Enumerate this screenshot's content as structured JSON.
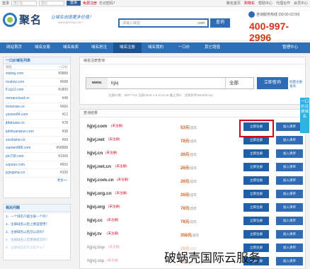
{
  "topbar": {
    "user_placeholder": "用户名",
    "pass_placeholder": "密码",
    "login_label": "登录",
    "free_register": "免费注册",
    "forgot": "忘记密码？",
    "links": [
      "聚名首页",
      "购物车",
      "帮助中心",
      "代理合作",
      "会员中心"
    ]
  },
  "header": {
    "logo": "聚名",
    "slogan": "让域名创造更多价值！",
    "site": "www.juming.com",
    "search_placeholder": "请输入域名",
    "search_tld": ".com",
    "search_button": "查询",
    "hotline_label": "咨询服务热线 (09:00-22:00)",
    "hotline": "400-997-2996"
  },
  "nav": {
    "items": [
      "网站首页",
      "域名交易",
      "域名拍卖",
      "域名抢注",
      "域名注册",
      "域名我的",
      "一口价",
      "其它增值"
    ],
    "active_index": 4,
    "manage": "管理中心"
  },
  "sidebar": {
    "title": "一口价域名列表",
    "col_domain": "域名",
    "col_price": "一口价",
    "items": [
      {
        "domain": "xinjing.com",
        "price": "¥9888"
      },
      {
        "domain": "ncabsy.com",
        "price": "¥688"
      },
      {
        "domain": "fl.cp12.com",
        "price": "¥1800"
      },
      {
        "domain": "nvmancloud.cn",
        "price": "¥48"
      },
      {
        "domain": "brownise.cn",
        "price": "¥966"
      },
      {
        "domain": "youme84.com",
        "price": "¥12"
      },
      {
        "domain": "jbfahuive.cn",
        "price": "¥78"
      },
      {
        "domain": "ipbihuanqrun.com",
        "price": "¥38"
      },
      {
        "domain": "xinzhishe.cn",
        "price": "¥99"
      },
      {
        "domain": "xiamen888.com",
        "price": "¥58888"
      },
      {
        "domain": "pic738.com",
        "price": "¥1000"
      },
      {
        "domain": "szjurun.com",
        "price": "¥500"
      },
      {
        "domain": "jzjingshui.cn",
        "price": "¥100"
      }
    ],
    "more": "更多>>"
  },
  "related": {
    "title": "相关问题",
    "items": [
      "1、一个域名只能注册一个吗？",
      "2、注册域名以后上哪里使用？",
      "3、注册域名以后可以卖吗？",
      "4、注册域名以后需要提交吗？",
      "5、注册域名的方法是什么？"
    ]
  },
  "query": {
    "title": "域名注册查询",
    "prefix": "www.",
    "value": "hjjvj",
    "suffix_option": "全部",
    "button": "立即查询",
    "bulk_link": "批量注册查询",
    "hint": "注册价格：800**742 注册2019-1-8 9:23:40 截止到6：注册条件366008.top"
  },
  "results": {
    "title": "查询结果",
    "status_label": "(未注册)",
    "unit": "/首年",
    "register_label": "立即注册",
    "cart_label": "加入清单",
    "items": [
      {
        "domain": "hjjvj.com",
        "price": "53元"
      },
      {
        "domain": "hjjvj.net",
        "price": "78元"
      },
      {
        "domain": "hjjvj.cn",
        "price": "26元"
      },
      {
        "domain": "hjjvj.net.cn",
        "price": "26元"
      },
      {
        "domain": "hjjvj.com.cn",
        "price": "26元"
      },
      {
        "domain": "hjjvj.org.cn",
        "price": "26元"
      },
      {
        "domain": "hjjvj.org",
        "price": "78元"
      },
      {
        "domain": "hjjvj.cc",
        "price": "78元"
      },
      {
        "domain": "hjjvj.tv",
        "price": "358元"
      },
      {
        "domain": "hjjvj.top",
        "price": "26元"
      },
      {
        "domain": "hjjvj.vip",
        "price": "38元"
      }
    ]
  },
  "side_tab": "一口价注册域名",
  "watermark": "破蜗壳国际云服务"
}
